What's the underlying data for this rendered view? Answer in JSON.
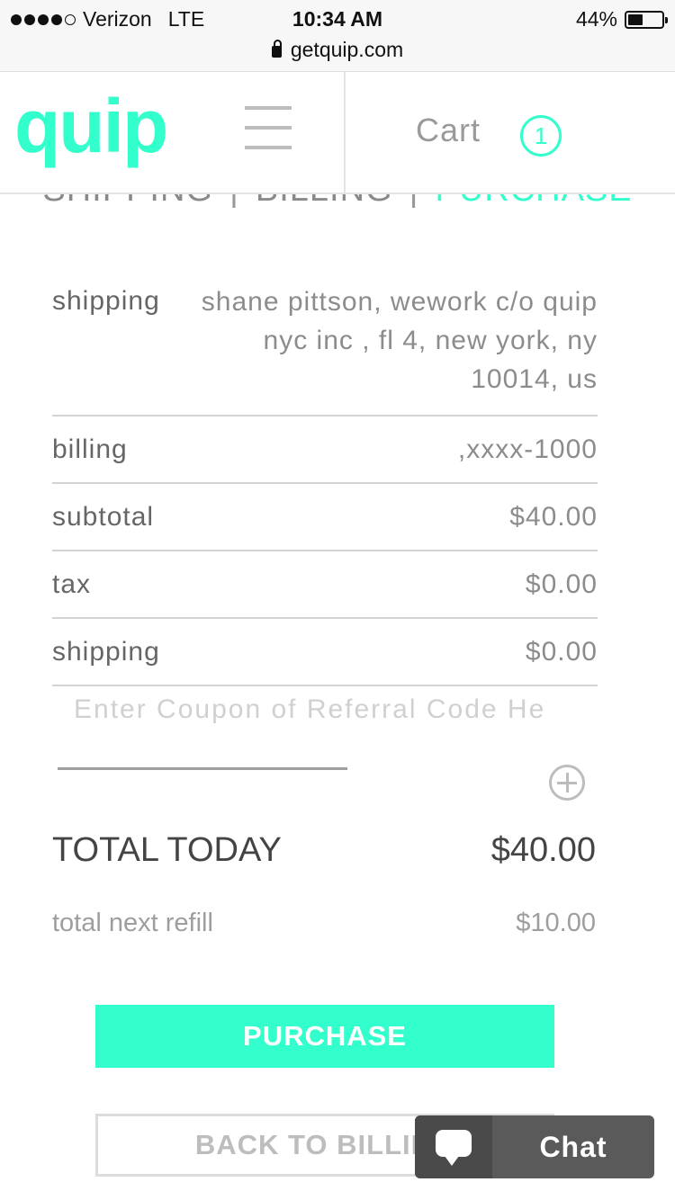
{
  "status_bar": {
    "carrier": "Verizon",
    "network": "LTE",
    "time": "10:34 AM",
    "url": "getquip.com",
    "battery": "44%",
    "battery_level": 0.44
  },
  "header": {
    "logo": "quip",
    "cart_label": "Cart",
    "cart_count": "1"
  },
  "steps": {
    "shipping": "SHIPPING",
    "separator": "|",
    "billing": "BILLING",
    "purchase": "PURCHASE"
  },
  "summary": {
    "shipping_label": "shipping",
    "shipping_address": "shane pittson, wework c/o quip nyc inc , fl 4, new york, ny 10014, us",
    "billing_label": "billing",
    "billing_value": ",xxxx-1000",
    "subtotal_label": "subtotal",
    "subtotal_value": "$40.00",
    "tax_label": "tax",
    "tax_value": "$0.00",
    "shipping_cost_label": "shipping",
    "shipping_cost_value": "$0.00"
  },
  "coupon": {
    "placeholder": "Enter Coupon of Referral Code He"
  },
  "totals": {
    "today_label": "TOTAL TODAY",
    "today_value": "$40.00",
    "refill_label": "total next refill",
    "refill_value": "$10.00"
  },
  "buttons": {
    "purchase": "PURCHASE",
    "back": "BACK TO BILLING"
  },
  "chat": {
    "label": "Chat"
  },
  "colors": {
    "accent": "#33ffcc"
  }
}
